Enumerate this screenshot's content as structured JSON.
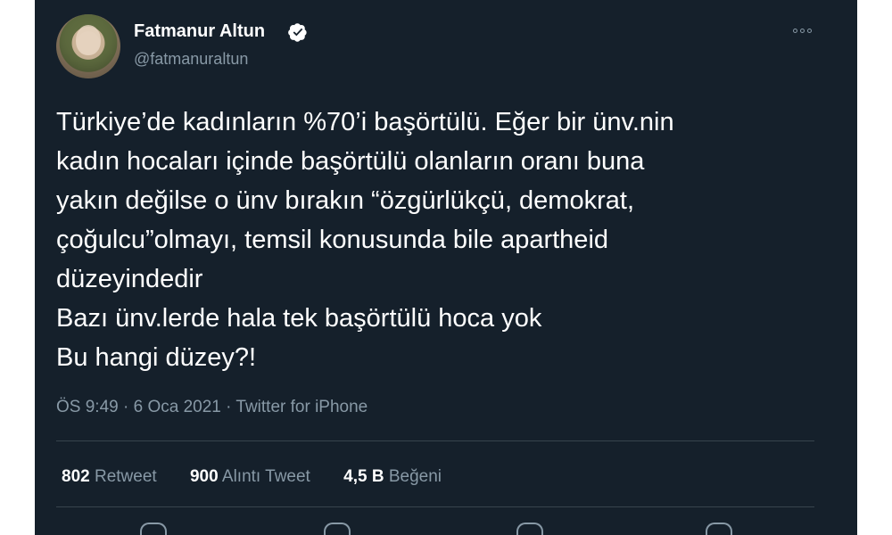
{
  "author": {
    "display_name": "Fatmanur Altun",
    "username": "@fatmanuraltun"
  },
  "tweet": {
    "text": "Türkiye’de kadınların %70’i başörtülü. Eğer bir ünv.nin\nkadın hocaları içinde başörtülü olanların oranı buna\nyakın değilse o ünv bırakın “özgürlükçü, demokrat,\nçoğulcu”olmayı, temsil konusunda bile apartheid\ndüzeyindedir\nBazı ünv.lerde hala tek başörtülü hoca yok\nBu hangi düzey?!",
    "time": "ÖS 9:49",
    "date": "6 Oca 2021",
    "source": "Twitter for iPhone",
    "separator": "·"
  },
  "stats": {
    "retweets": {
      "count": "802",
      "label": "Retweet"
    },
    "quotes": {
      "count": "900",
      "label": "Alıntı Tweet"
    },
    "likes": {
      "count": "4,5 B",
      "label": "Beğeni"
    }
  },
  "icons": [
    "verified-badge-icon",
    "more-options-icon",
    "reply-icon",
    "retweet-icon",
    "like-icon",
    "share-icon"
  ],
  "colors": {
    "background": "#15202b",
    "text_primary": "#ffffff",
    "text_secondary": "#8899a6",
    "divider": "#38444d"
  }
}
